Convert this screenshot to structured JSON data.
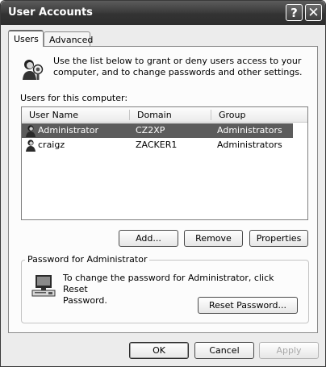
{
  "window": {
    "title": "User Accounts",
    "help_glyph": "?",
    "close_glyph": "✕"
  },
  "tabs": [
    {
      "label": "Users"
    },
    {
      "label": "Advanced"
    }
  ],
  "intro": {
    "line1": "Use the list below to grant or deny users access to your",
    "line2": "computer, and to change passwords and other settings."
  },
  "users_label": "Users for this computer:",
  "list": {
    "columns": [
      "User Name",
      "Domain",
      "Group"
    ],
    "rows": [
      {
        "name": "Administrator",
        "domain": "CZ2XP",
        "group": "Administrators",
        "selected": true
      },
      {
        "name": "craigz",
        "domain": "ZACKER1",
        "group": "Administrators",
        "selected": false
      }
    ]
  },
  "list_buttons": {
    "add": "Add...",
    "remove": "Remove",
    "properties": "Properties"
  },
  "password_group": {
    "legend": "Password for Administrator",
    "line1": "To change the password for Administrator, click Reset",
    "line2": "Password.",
    "reset_button": "Reset Password..."
  },
  "dialog_buttons": {
    "ok": "OK",
    "cancel": "Cancel",
    "apply": "Apply"
  },
  "colors": {
    "selection": "#5c5c5c",
    "titlebar": "#3d3d3d"
  }
}
